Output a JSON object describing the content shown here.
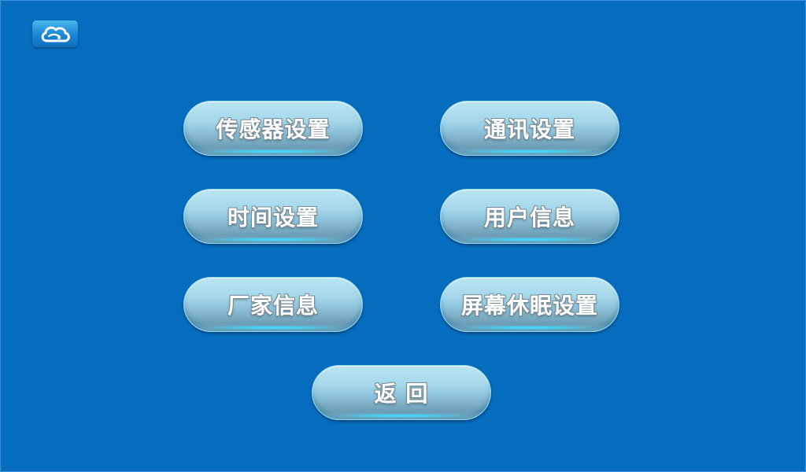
{
  "header": {
    "logo_icon": "cloud-icon"
  },
  "menu": {
    "sensor_settings": "传感器设置",
    "comm_settings": "通讯设置",
    "time_settings": "时间设置",
    "user_info": "用户信息",
    "vendor_info": "厂家信息",
    "screen_sleep_settings": "屏幕休眠设置",
    "back": "返 回"
  },
  "colors": {
    "background": "#066cbd",
    "button_top": "#b9e4f1",
    "button_bottom": "#6f9fb8",
    "button_glow": "#3fe0ff",
    "label": "#ffffff"
  }
}
